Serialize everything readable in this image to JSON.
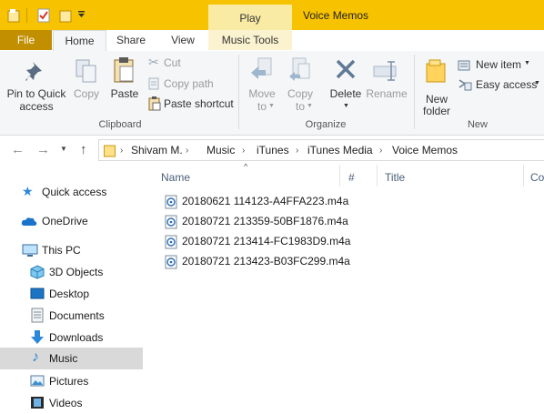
{
  "window": {
    "title": "Voice Memos",
    "contextual_tab": "Play"
  },
  "tabs": {
    "file": "File",
    "home": "Home",
    "share": "Share",
    "view": "View",
    "music_tools": "Music Tools"
  },
  "ribbon": {
    "clipboard": {
      "pin_label_1": "Pin to Quick",
      "pin_label_2": "access",
      "copy": "Copy",
      "paste": "Paste",
      "cut": "Cut",
      "copy_path": "Copy path",
      "paste_shortcut": "Paste shortcut",
      "group": "Clipboard"
    },
    "organize": {
      "move_to_1": "Move",
      "move_to_2": "to",
      "copy_to_1": "Copy",
      "copy_to_2": "to",
      "delete": "Delete",
      "rename": "Rename",
      "group": "Organize"
    },
    "new": {
      "new_folder_1": "New",
      "new_folder_2": "folder",
      "new_item": "New item",
      "easy_access": "Easy access",
      "group": "New"
    }
  },
  "address": {
    "crumbs": [
      "Shivam M.",
      "Music",
      "iTunes",
      "iTunes Media",
      "Voice Memos"
    ]
  },
  "columns": {
    "name": "Name",
    "number": "#",
    "title": "Title",
    "contributing": "Co"
  },
  "nav": {
    "quick_access": "Quick access",
    "onedrive": "OneDrive",
    "this_pc": "This PC",
    "objects3d": "3D Objects",
    "desktop": "Desktop",
    "documents": "Documents",
    "downloads": "Downloads",
    "music": "Music",
    "pictures": "Pictures",
    "videos": "Videos"
  },
  "files": [
    "20180621 114123-A4FFA223.m4a",
    "20180721 213359-50BF1876.m4a",
    "20180721 213414-FC1983D9.m4a",
    "20180721 213423-B03FC299.m4a"
  ],
  "colors": {
    "title_bar": "#f7c200",
    "file_tab": "#c28f00",
    "play_tab": "#f9eba3",
    "selected_nav": "#d9d9d9"
  }
}
